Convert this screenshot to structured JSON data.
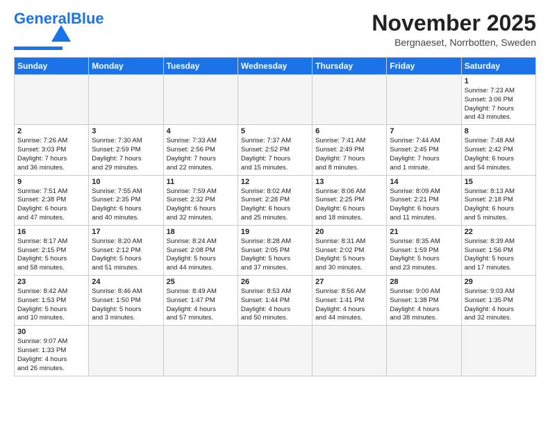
{
  "header": {
    "logo": {
      "text_general": "General",
      "text_blue": "Blue"
    },
    "month_year": "November 2025",
    "location": "Bergnaeset, Norrbotten, Sweden"
  },
  "weekdays": [
    "Sunday",
    "Monday",
    "Tuesday",
    "Wednesday",
    "Thursday",
    "Friday",
    "Saturday"
  ],
  "weeks": [
    [
      {
        "day": "",
        "info": "",
        "empty": true
      },
      {
        "day": "",
        "info": "",
        "empty": true
      },
      {
        "day": "",
        "info": "",
        "empty": true
      },
      {
        "day": "",
        "info": "",
        "empty": true
      },
      {
        "day": "",
        "info": "",
        "empty": true
      },
      {
        "day": "",
        "info": "",
        "empty": true
      },
      {
        "day": "1",
        "info": "Sunrise: 7:23 AM\nSunset: 3:06 PM\nDaylight: 7 hours\nand 43 minutes."
      }
    ],
    [
      {
        "day": "2",
        "info": "Sunrise: 7:26 AM\nSunset: 3:03 PM\nDaylight: 7 hours\nand 36 minutes."
      },
      {
        "day": "3",
        "info": "Sunrise: 7:30 AM\nSunset: 2:59 PM\nDaylight: 7 hours\nand 29 minutes."
      },
      {
        "day": "4",
        "info": "Sunrise: 7:33 AM\nSunset: 2:56 PM\nDaylight: 7 hours\nand 22 minutes."
      },
      {
        "day": "5",
        "info": "Sunrise: 7:37 AM\nSunset: 2:52 PM\nDaylight: 7 hours\nand 15 minutes."
      },
      {
        "day": "6",
        "info": "Sunrise: 7:41 AM\nSunset: 2:49 PM\nDaylight: 7 hours\nand 8 minutes."
      },
      {
        "day": "7",
        "info": "Sunrise: 7:44 AM\nSunset: 2:45 PM\nDaylight: 7 hours\nand 1 minute."
      },
      {
        "day": "8",
        "info": "Sunrise: 7:48 AM\nSunset: 2:42 PM\nDaylight: 6 hours\nand 54 minutes."
      }
    ],
    [
      {
        "day": "9",
        "info": "Sunrise: 7:51 AM\nSunset: 2:38 PM\nDaylight: 6 hours\nand 47 minutes."
      },
      {
        "day": "10",
        "info": "Sunrise: 7:55 AM\nSunset: 2:35 PM\nDaylight: 6 hours\nand 40 minutes."
      },
      {
        "day": "11",
        "info": "Sunrise: 7:59 AM\nSunset: 2:32 PM\nDaylight: 6 hours\nand 32 minutes."
      },
      {
        "day": "12",
        "info": "Sunrise: 8:02 AM\nSunset: 2:28 PM\nDaylight: 6 hours\nand 25 minutes."
      },
      {
        "day": "13",
        "info": "Sunrise: 8:06 AM\nSunset: 2:25 PM\nDaylight: 6 hours\nand 18 minutes."
      },
      {
        "day": "14",
        "info": "Sunrise: 8:09 AM\nSunset: 2:21 PM\nDaylight: 6 hours\nand 11 minutes."
      },
      {
        "day": "15",
        "info": "Sunrise: 8:13 AM\nSunset: 2:18 PM\nDaylight: 6 hours\nand 5 minutes."
      }
    ],
    [
      {
        "day": "16",
        "info": "Sunrise: 8:17 AM\nSunset: 2:15 PM\nDaylight: 5 hours\nand 58 minutes."
      },
      {
        "day": "17",
        "info": "Sunrise: 8:20 AM\nSunset: 2:12 PM\nDaylight: 5 hours\nand 51 minutes."
      },
      {
        "day": "18",
        "info": "Sunrise: 8:24 AM\nSunset: 2:08 PM\nDaylight: 5 hours\nand 44 minutes."
      },
      {
        "day": "19",
        "info": "Sunrise: 8:28 AM\nSunset: 2:05 PM\nDaylight: 5 hours\nand 37 minutes."
      },
      {
        "day": "20",
        "info": "Sunrise: 8:31 AM\nSunset: 2:02 PM\nDaylight: 5 hours\nand 30 minutes."
      },
      {
        "day": "21",
        "info": "Sunrise: 8:35 AM\nSunset: 1:59 PM\nDaylight: 5 hours\nand 23 minutes."
      },
      {
        "day": "22",
        "info": "Sunrise: 8:39 AM\nSunset: 1:56 PM\nDaylight: 5 hours\nand 17 minutes."
      }
    ],
    [
      {
        "day": "23",
        "info": "Sunrise: 8:42 AM\nSunset: 1:53 PM\nDaylight: 5 hours\nand 10 minutes."
      },
      {
        "day": "24",
        "info": "Sunrise: 8:46 AM\nSunset: 1:50 PM\nDaylight: 5 hours\nand 3 minutes."
      },
      {
        "day": "25",
        "info": "Sunrise: 8:49 AM\nSunset: 1:47 PM\nDaylight: 4 hours\nand 57 minutes."
      },
      {
        "day": "26",
        "info": "Sunrise: 8:53 AM\nSunset: 1:44 PM\nDaylight: 4 hours\nand 50 minutes."
      },
      {
        "day": "27",
        "info": "Sunrise: 8:56 AM\nSunset: 1:41 PM\nDaylight: 4 hours\nand 44 minutes."
      },
      {
        "day": "28",
        "info": "Sunrise: 9:00 AM\nSunset: 1:38 PM\nDaylight: 4 hours\nand 38 minutes."
      },
      {
        "day": "29",
        "info": "Sunrise: 9:03 AM\nSunset: 1:35 PM\nDaylight: 4 hours\nand 32 minutes."
      }
    ],
    [
      {
        "day": "30",
        "info": "Sunrise: 9:07 AM\nSunset: 1:33 PM\nDaylight: 4 hours\nand 26 minutes."
      },
      {
        "day": "",
        "info": "",
        "empty": true
      },
      {
        "day": "",
        "info": "",
        "empty": true
      },
      {
        "day": "",
        "info": "",
        "empty": true
      },
      {
        "day": "",
        "info": "",
        "empty": true
      },
      {
        "day": "",
        "info": "",
        "empty": true
      },
      {
        "day": "",
        "info": "",
        "empty": true
      }
    ]
  ]
}
